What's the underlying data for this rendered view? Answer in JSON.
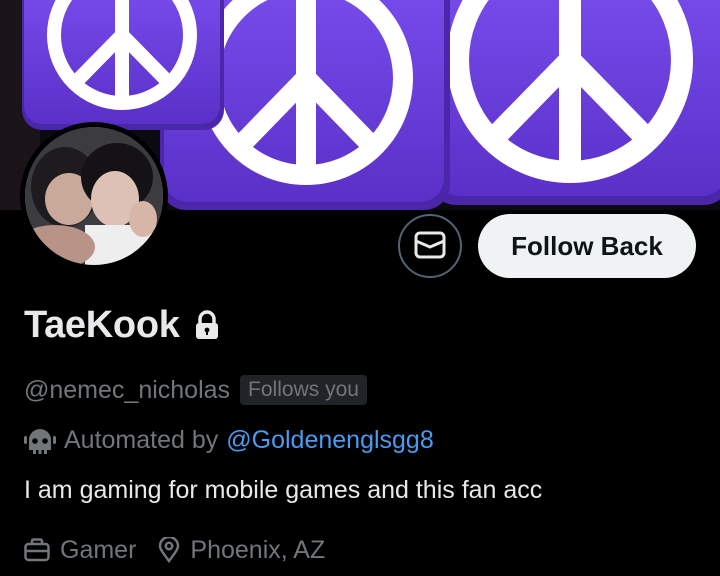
{
  "profile": {
    "display_name": "TaeKook",
    "handle": "@nemec_nicholas",
    "follows_you": "Follows you",
    "automated_prefix": "Automated by",
    "automated_by": "@Goldenenglsgg8",
    "bio": "I am gaming for mobile games and this fan acc",
    "category": "Gamer",
    "location": "Phoenix, AZ",
    "protected": true
  },
  "actions": {
    "message_icon": "mail-icon",
    "follow_label": "Follow Back"
  },
  "banner": {
    "description_icon": "peace-sign-icon",
    "tile_color": "#6a3fd8",
    "symbol_color": "#ffffff"
  },
  "icons": {
    "lock": "lock-icon",
    "bot": "bot-icon",
    "category": "briefcase-icon",
    "location": "location-pin-icon"
  },
  "colors": {
    "background": "#000000",
    "text_primary": "#e7e9ea",
    "text_secondary": "#71767b",
    "link": "#4b9aef",
    "button_bg": "#eff3f4",
    "button_text": "#0f1419"
  }
}
